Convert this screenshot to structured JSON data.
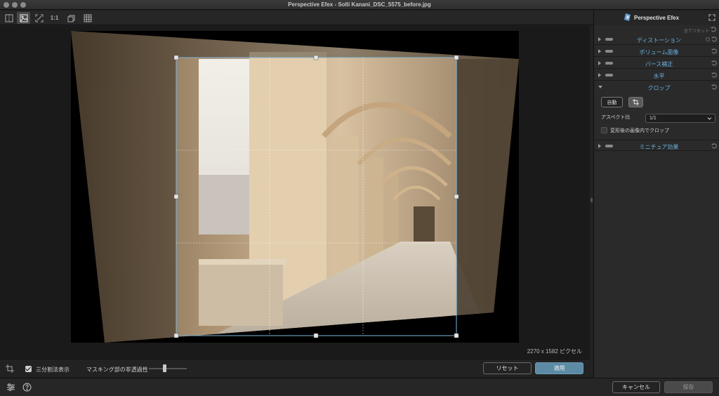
{
  "window": {
    "title": "Perspective Efex - Solli Kanani_DSC_5575_before.jpg"
  },
  "toolbar": {
    "buttons": [
      {
        "name": "split-view-icon",
        "active": false
      },
      {
        "name": "image-view-icon",
        "active": true
      },
      {
        "name": "fit-screen-icon",
        "active": false
      },
      {
        "name": "zoom-100",
        "label": "1:1",
        "active": false
      },
      {
        "name": "compare-icon",
        "active": false
      },
      {
        "name": "grid-icon",
        "active": false
      }
    ]
  },
  "canvas": {
    "pixel_info": "2270 x 1582 ピクセル"
  },
  "canvas_bar": {
    "rule_of_thirds_label": "三分割法表示",
    "rule_of_thirds_checked": true,
    "mask_opacity_label": "マスキング部の非透過性",
    "mask_opacity_value": 0.4,
    "reset_label": "リセット",
    "apply_label": "適用"
  },
  "footer": {
    "cancel_label": "キャンセル",
    "save_label": "保存"
  },
  "panel": {
    "brand": "Perspective Efex",
    "reset_all": "全てリセット",
    "sections": [
      {
        "title": "ディストーション",
        "expanded": false
      },
      {
        "title": "ボリューム面像",
        "expanded": false
      },
      {
        "title": "パース補正",
        "expanded": false
      },
      {
        "title": "水平",
        "expanded": false
      },
      {
        "title": "クロップ",
        "expanded": true
      },
      {
        "title": "ミニチュア効果",
        "expanded": false
      }
    ],
    "crop": {
      "auto_label": "自動",
      "aspect_label": "アスペクト比",
      "aspect_value": "1/1",
      "crop_inside_label": "変形後の画像内でクロップ",
      "crop_inside_checked": false
    }
  },
  "colors": {
    "accent": "#6ab0e0",
    "apply_button": "#5c8ba6",
    "panel_bg": "#2a2a2a"
  }
}
